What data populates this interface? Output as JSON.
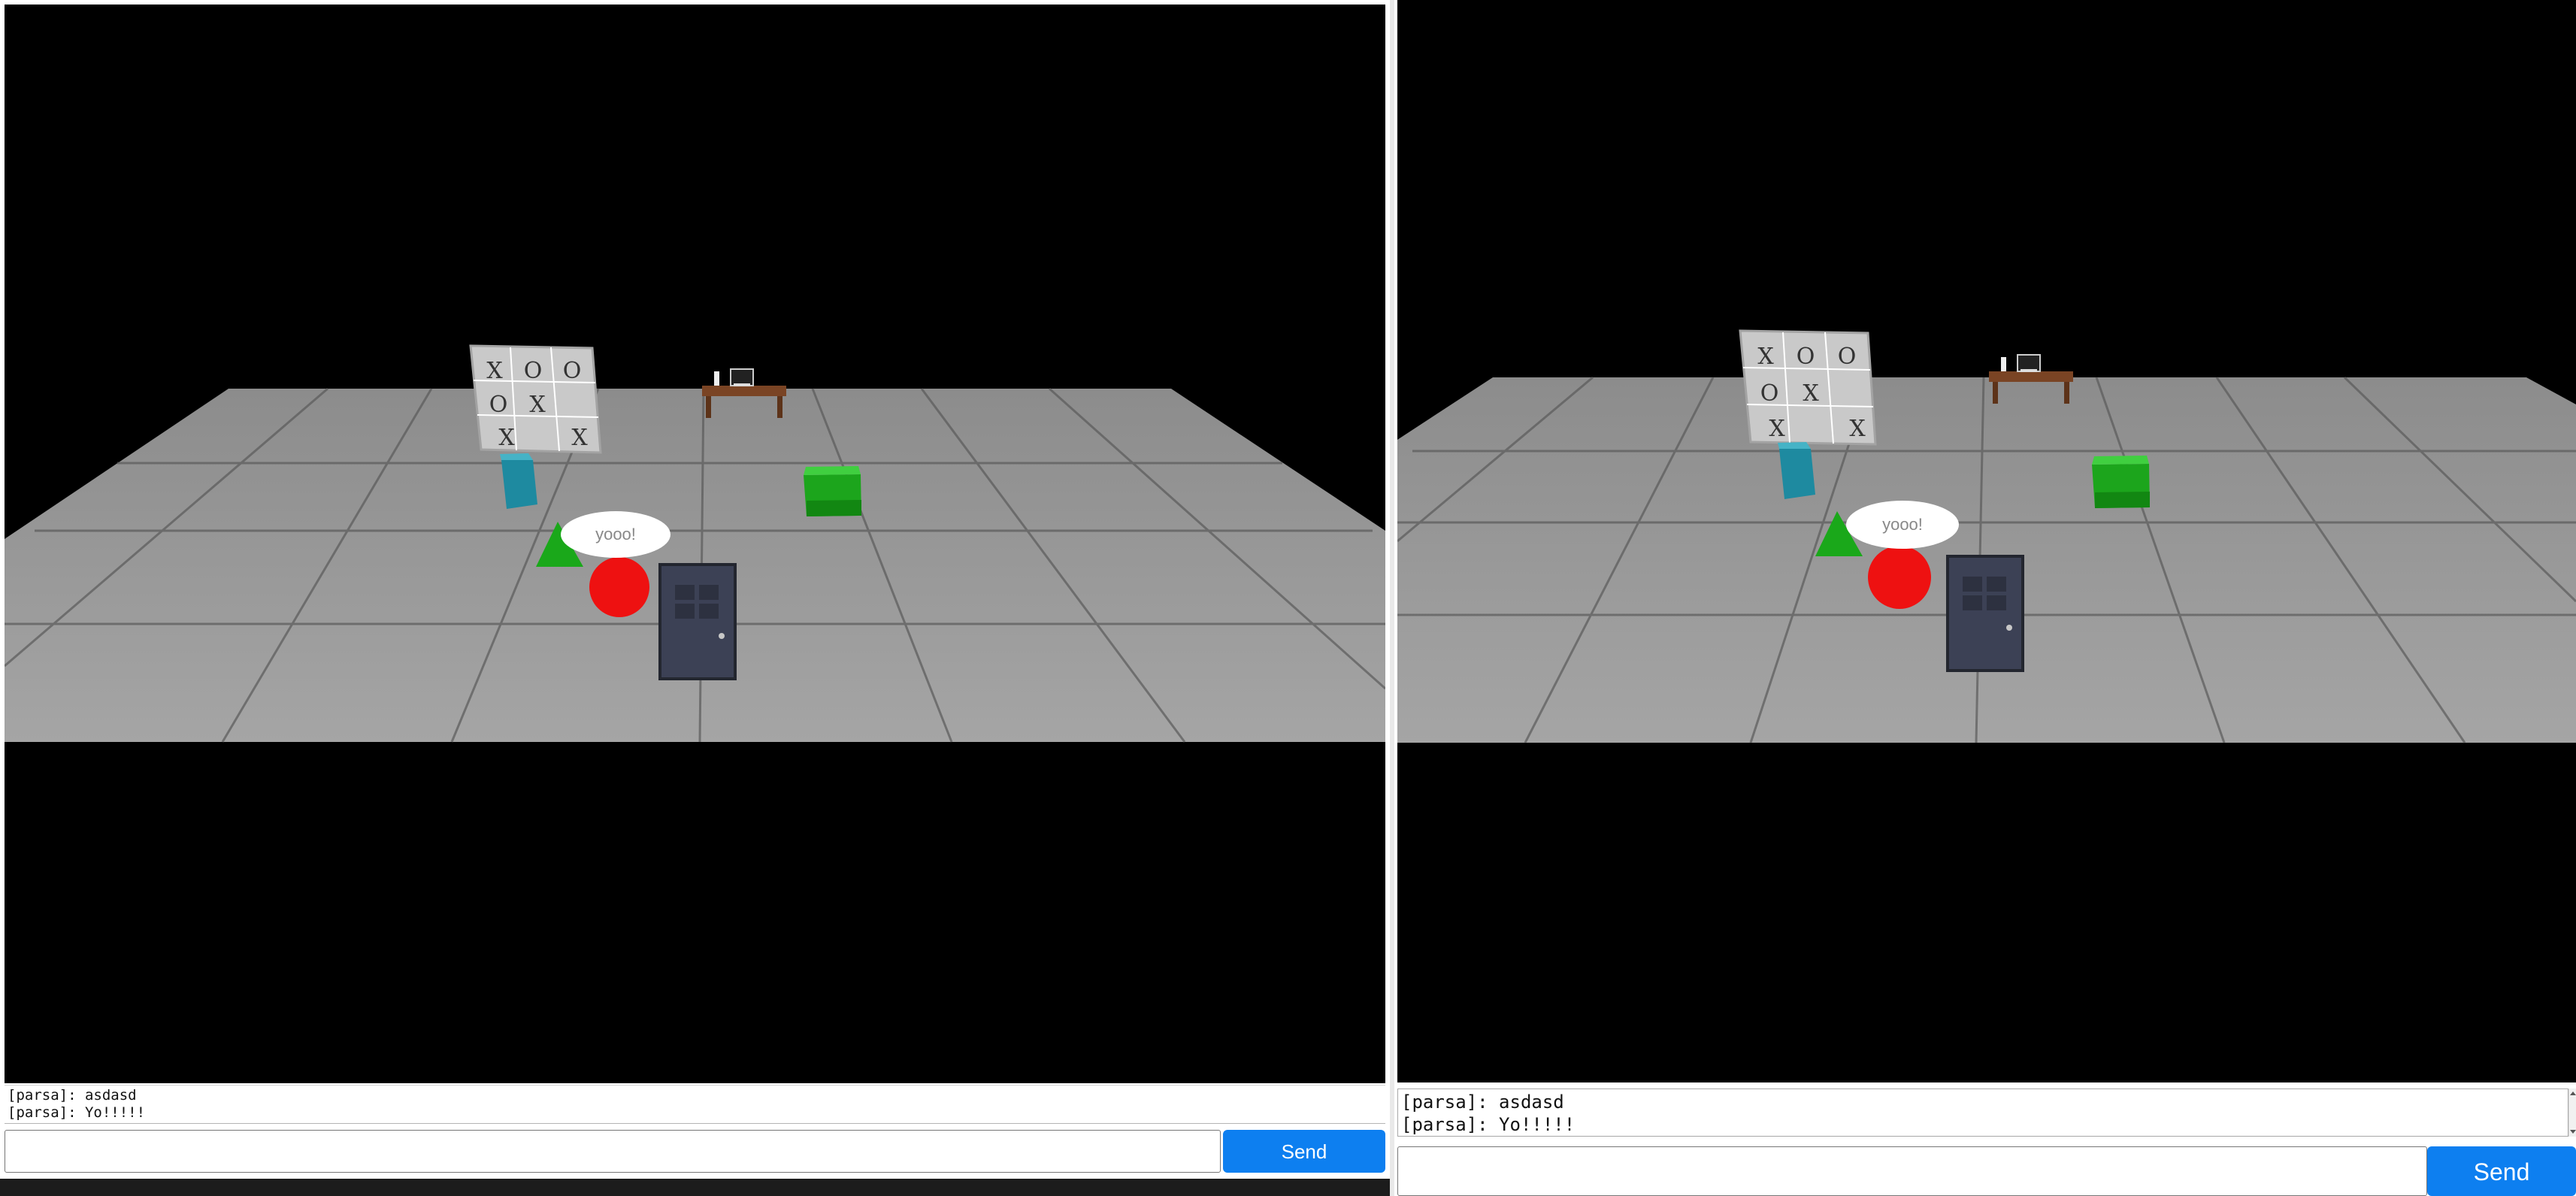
{
  "scene": {
    "speech_bubble": "yooo!",
    "board_cells": [
      "X",
      "O",
      "O",
      "O",
      "X",
      "",
      "X",
      "",
      "X"
    ],
    "colors": {
      "background": "#000000",
      "floor": "#9e9e9e",
      "board": "#c9c9c9",
      "player": "#ee1111",
      "cone": "#1aa81a",
      "green_box": "#1ca51c",
      "teal_box": "#1e8aa0",
      "door": "#3c4155",
      "table": "#7a4424"
    }
  },
  "chat": {
    "messages": [
      "[parsa]: asdasd",
      "[parsa]: Yo!!!!!"
    ],
    "input_placeholder": "",
    "send_label": "Send"
  },
  "icons": {
    "scroll_up": "chevron-up-icon",
    "scroll_down": "chevron-down-icon"
  }
}
